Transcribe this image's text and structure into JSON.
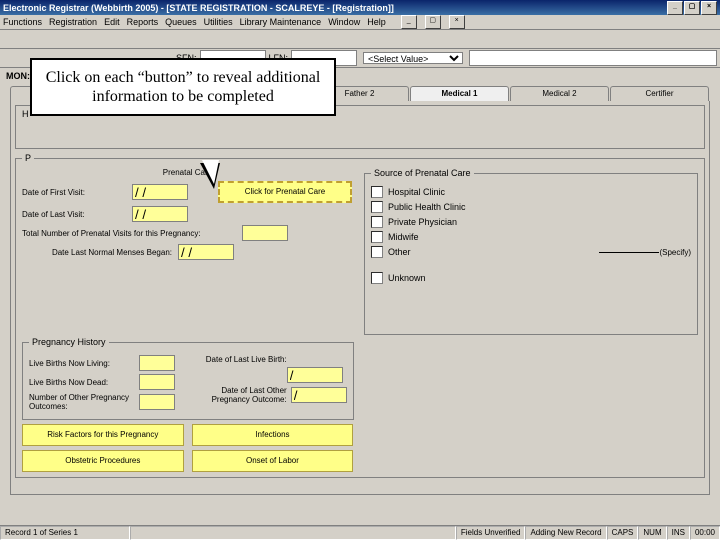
{
  "window_title": "Electronic Registrar (Webbirth 2005) - [STATE REGISTRATION - SCALREYE - [Registration]]",
  "menu": [
    "Functions",
    "Registration",
    "Edit",
    "Reports",
    "Queues",
    "Utilities",
    "Library Maintenance",
    "Window",
    "Help"
  ],
  "search": {
    "sfn_lbl": "SFN:",
    "lfn_lbl": "LFN:"
  },
  "mon_lbl": "MON:",
  "tabs": [
    "",
    "",
    "",
    "Father 2",
    "Medical 1",
    "Medical 2",
    "Certifier"
  ],
  "active_tab": 4,
  "callout": "Click on each “button” to reveal additional information to be completed",
  "fs1_legend": "H",
  "fs2_legend": "P",
  "prenatal_label": "Prenatal Care*",
  "first_visit": "Date of First Visit:",
  "last_visit": "Date of Last Visit:",
  "total_visits": "Total Number of Prenatal Visits for this Pregnancy:",
  "last_menses": "Date Last Normal Menses Began:",
  "click_prenatal": "Click for Prenatal Care",
  "source_legend": "Source of Prenatal Care",
  "sources": [
    "Hospital Clinic",
    "Public Health Clinic",
    "Private Physician",
    "Midwife",
    "Other"
  ],
  "specify_lbl": "(Specify)",
  "unknown_lbl": "Unknown",
  "preg_hist": "Pregnancy History",
  "live_living": "Live Births Now Living:",
  "live_dead": "Live Births Now Dead:",
  "other_outcomes": "Number of Other Pregnancy Outcomes:",
  "date_last_birth": "Date of Last Live Birth:",
  "date_last_outcome": "Date of Last Other Pregnancy Outcome:",
  "btn_risk": "Risk Factors for this Pregnancy",
  "btn_infections": "Infections",
  "btn_obstetric": "Obstetric Procedures",
  "btn_onset": "Onset of Labor",
  "status_left": "Record 1 of Series 1",
  "status_mid": "Fields Unverified",
  "status_view": "Adding New Record",
  "status_caps": "CAPS",
  "status_num": "NUM",
  "status_ins": "INS",
  "status_time": "00:00"
}
